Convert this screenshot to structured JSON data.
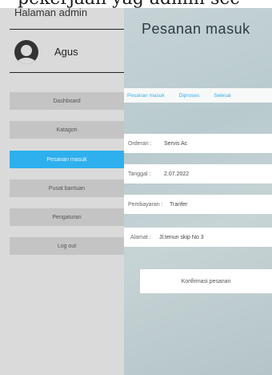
{
  "caption": "pekerjaan yag admin sec",
  "sidebar": {
    "title": "Halaman admin",
    "user": {
      "name": "Agus",
      "avatar_icon": "user-avatar-icon"
    },
    "items": [
      {
        "label": "Dashboard",
        "active": false
      },
      {
        "label": "Katagori",
        "active": false
      },
      {
        "label": "Pesanan masuk",
        "active": true
      },
      {
        "label": "Pusat bantuan",
        "active": false
      },
      {
        "label": "Pengaturan",
        "active": false
      },
      {
        "label": "Log out",
        "active": false
      }
    ]
  },
  "main": {
    "title": "Pesanan masuk",
    "tabs": [
      "Pesanan masuk",
      "Diproses",
      "Selesai"
    ],
    "fields": [
      {
        "label": "Orderan :",
        "value": "Servis Ac"
      },
      {
        "label": "Tanggal :",
        "value": "2.07.2022"
      },
      {
        "label": "Pembayaran :",
        "value": "Tranfer"
      },
      {
        "label": "Alamat :",
        "value": "Jl.tenun skip No 3"
      }
    ],
    "confirm_label": "Konfirmasi pesanan"
  },
  "colors": {
    "accent": "#2eb0ef",
    "sidebar": "#dadada",
    "nav": "#c4c4c4"
  }
}
